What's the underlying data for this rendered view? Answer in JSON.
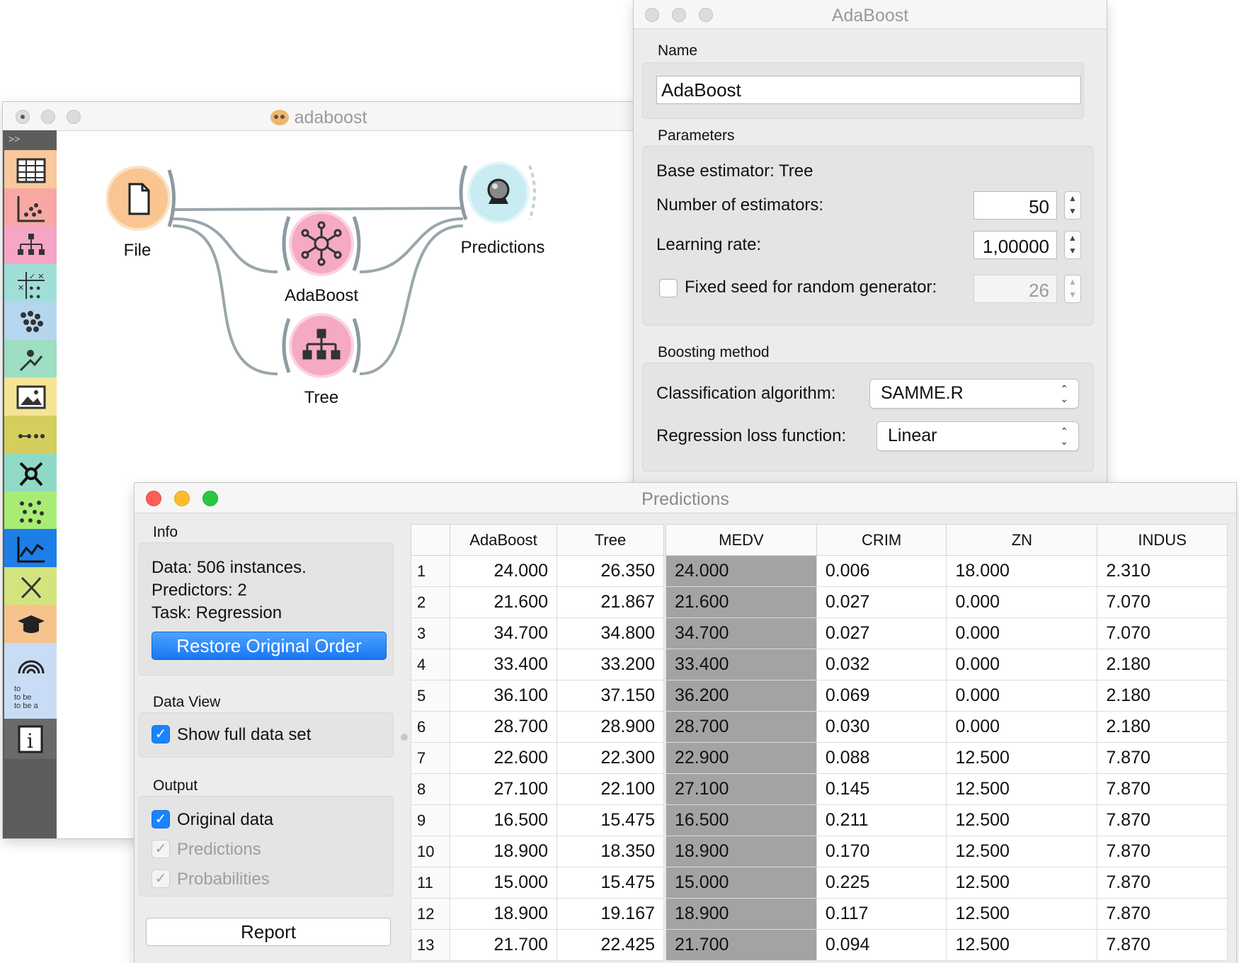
{
  "canvas": {
    "window_title": "adaboost",
    "toolbox_expand": ">>",
    "nodes": {
      "file": "File",
      "adaboost": "AdaBoost",
      "tree": "Tree",
      "predictions": "Predictions"
    },
    "toolbox_colors": [
      "#f9c89b",
      "#f7a8a3",
      "#f6a5c6",
      "#9fdfd8",
      "#b5d6ef",
      "#9edec3",
      "#f4e494",
      "#d4ce5c",
      "#8fdac7",
      "#a9ec74",
      "#1d7ee8",
      "#d3e47e",
      "#f7c38c",
      "#c8ddf5",
      "#c8ddf5",
      "#6a6a6a"
    ],
    "toolbox_icons": [
      "data-table-icon",
      "scatter-plot-icon",
      "tree-viewer-icon",
      "confusion-matrix-icon",
      "cluster-icon",
      "mds-icon",
      "image-viewer-icon",
      "line-icon",
      "network-icon",
      "som-icon",
      "line-chart-icon",
      "bioinformatics-icon",
      "education-icon",
      "geo-icon",
      "text-mining-icon",
      "info-icon"
    ],
    "toolbox_text_icon": "to\nto be\nto be a"
  },
  "adaboost": {
    "window_title": "AdaBoost",
    "name_label": "Name",
    "name_value": "AdaBoost",
    "parameters_label": "Parameters",
    "base_estimator": "Base estimator: Tree",
    "n_estimators_label": "Number of estimators:",
    "n_estimators_value": "50",
    "learning_rate_label": "Learning rate:",
    "learning_rate_value": "1,00000",
    "fixed_seed_label": "Fixed seed for random generator:",
    "fixed_seed_value": "26",
    "boosting_label": "Boosting method",
    "class_algo_label": "Classification algorithm:",
    "class_algo_value": "SAMME.R",
    "reg_loss_label": "Regression loss function:",
    "reg_loss_value": "Linear"
  },
  "predictions": {
    "window_title": "Predictions",
    "info_label": "Info",
    "info_lines": [
      "Data: 506 instances.",
      "Predictors: 2",
      "Task: Regression"
    ],
    "restore_button": "Restore Original Order",
    "data_view_label": "Data View",
    "show_full": "Show full data set",
    "output_label": "Output",
    "out_original": "Original data",
    "out_predictions": "Predictions",
    "out_probabilities": "Probabilities",
    "report_button": "Report",
    "pred_headers": [
      "AdaBoost",
      "Tree"
    ],
    "data_headers": [
      "MEDV",
      "CRIM",
      "ZN",
      "INDUS"
    ],
    "rows": [
      [
        "1",
        "24.000",
        "26.350",
        "24.000",
        "0.006",
        "18.000",
        "2.310"
      ],
      [
        "2",
        "21.600",
        "21.867",
        "21.600",
        "0.027",
        "0.000",
        "7.070"
      ],
      [
        "3",
        "34.700",
        "34.800",
        "34.700",
        "0.027",
        "0.000",
        "7.070"
      ],
      [
        "4",
        "33.400",
        "33.200",
        "33.400",
        "0.032",
        "0.000",
        "2.180"
      ],
      [
        "5",
        "36.100",
        "37.150",
        "36.200",
        "0.069",
        "0.000",
        "2.180"
      ],
      [
        "6",
        "28.700",
        "28.900",
        "28.700",
        "0.030",
        "0.000",
        "2.180"
      ],
      [
        "7",
        "22.600",
        "22.300",
        "22.900",
        "0.088",
        "12.500",
        "7.870"
      ],
      [
        "8",
        "27.100",
        "22.100",
        "27.100",
        "0.145",
        "12.500",
        "7.870"
      ],
      [
        "9",
        "16.500",
        "15.475",
        "16.500",
        "0.211",
        "12.500",
        "7.870"
      ],
      [
        "10",
        "18.900",
        "18.350",
        "18.900",
        "0.170",
        "12.500",
        "7.870"
      ],
      [
        "11",
        "15.000",
        "15.475",
        "15.000",
        "0.225",
        "12.500",
        "7.870"
      ],
      [
        "12",
        "18.900",
        "19.167",
        "18.900",
        "0.117",
        "12.500",
        "7.870"
      ],
      [
        "13",
        "21.700",
        "22.425",
        "21.700",
        "0.094",
        "12.500",
        "7.870"
      ]
    ]
  }
}
